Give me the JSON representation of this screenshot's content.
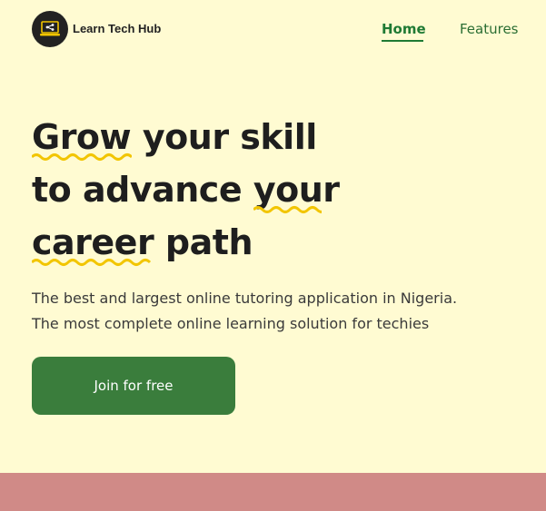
{
  "header": {
    "brand": "Learn Tech Hub",
    "logo_icon": "laptop-share-icon",
    "nav": [
      {
        "label": "Home",
        "active": true
      },
      {
        "label": "Features",
        "active": false
      }
    ]
  },
  "hero": {
    "headline": {
      "line1_a": "Grow",
      "line1_b": " your skill",
      "line2_a": "to advance ",
      "line2_b": "your",
      "line3_a": "career",
      "line3_b": " path"
    },
    "subtitle_line1": "The best and largest online tutoring application in Nigeria.",
    "subtitle_line2": "The most complete online learning solution for techies",
    "cta_label": "Join for free"
  },
  "colors": {
    "background": "#fffbd2",
    "accent_green": "#3a7d3c",
    "nav_green": "#1f7a34",
    "wavy_underline": "#f2c500",
    "bottom_band": "#d08a87"
  }
}
